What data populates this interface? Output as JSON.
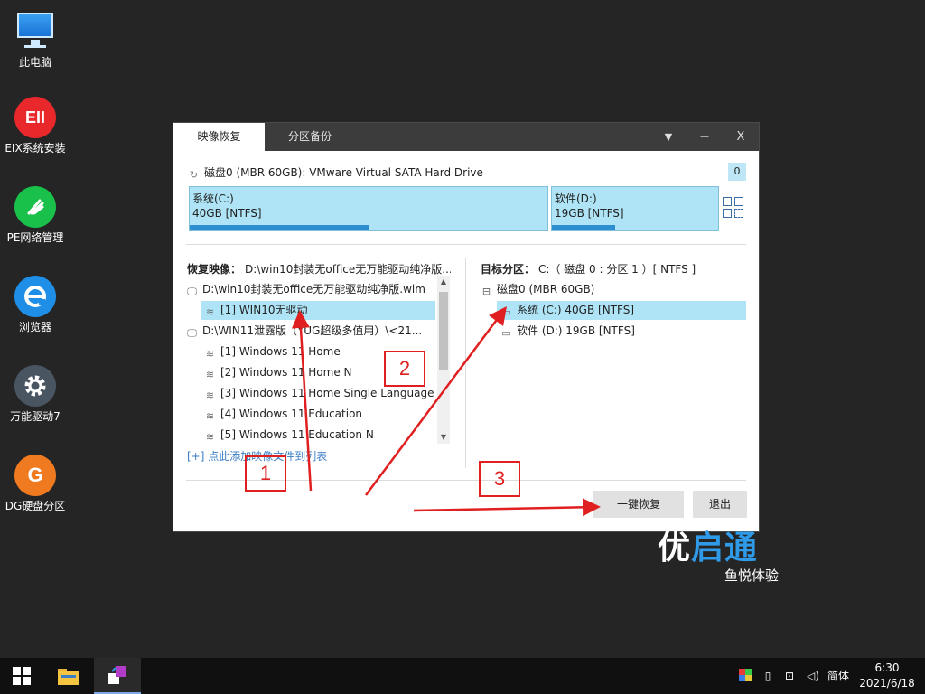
{
  "desktop": {
    "icons": [
      {
        "label": "此电脑"
      },
      {
        "label": "EIX系统安装",
        "text": "EII",
        "color": "#e8282a"
      },
      {
        "label": "PE网络管理",
        "color": "#19c04a"
      },
      {
        "label": "浏览器",
        "color": "#1e8ee6"
      },
      {
        "label": "万能驱动7",
        "color": "#4a5562"
      },
      {
        "label": "DG硬盘分区",
        "text": "G",
        "color": "#f07a20"
      }
    ]
  },
  "window": {
    "tabs": [
      "映像恢复",
      "分区备份"
    ],
    "controls": {
      "dropdown": "▼",
      "minimize": "—",
      "close": "X"
    },
    "disk_label": "磁盘0 (MBR 60GB): VMware Virtual SATA Hard Drive",
    "disk_index": "0",
    "partitions": [
      {
        "name": "系统(C:)",
        "size": "40GB [NTFS]",
        "used_fraction": 0.5
      },
      {
        "name": "软件(D:)",
        "size": "19GB [NTFS]",
        "used_fraction": 0.38
      }
    ],
    "restore_image": {
      "label": "恢复映像：",
      "value": "D:\\win10封装无office无万能驱动纯净版...",
      "tree": [
        {
          "text": "D:\\win10封装无office无万能驱动纯净版.wim",
          "level": 0,
          "icon": "monitor"
        },
        {
          "text": "[1] WIN10无驱动",
          "level": 1,
          "icon": "layers",
          "selected": true
        },
        {
          "text": "D:\\WIN11泄露版（YUG超级多值用）\\<21...",
          "level": 0,
          "icon": "monitor"
        },
        {
          "text": "[1] Windows 11 Home",
          "level": 1,
          "icon": "layers"
        },
        {
          "text": "[2] Windows 11 Home N",
          "level": 1,
          "icon": "layers"
        },
        {
          "text": "[3] Windows 11 Home Single Language",
          "level": 1,
          "icon": "layers"
        },
        {
          "text": "[4] Windows 11 Education",
          "level": 1,
          "icon": "layers"
        },
        {
          "text": "[5] Windows 11 Education N",
          "level": 1,
          "icon": "layers"
        }
      ],
      "add_link": "[+] 点此添加映像文件到列表"
    },
    "target_partition": {
      "label": "目标分区：",
      "value": "C:（ 磁盘 0 : 分区 1 ）[ NTFS ]",
      "tree": [
        {
          "text": "磁盘0 (MBR 60GB)",
          "level": 0,
          "icon": "disk"
        },
        {
          "text": "系统 (C:) 40GB [NTFS]",
          "level": 1,
          "icon": "folder",
          "selected": true
        },
        {
          "text": "软件 (D:) 19GB [NTFS]",
          "level": 1,
          "icon": "folder"
        }
      ]
    },
    "buttons": {
      "restore": "一键恢复",
      "exit": "退出"
    }
  },
  "annotations": [
    "1",
    "2",
    "3"
  ],
  "brand": {
    "part1": "优",
    "part2": "启通",
    "sub": "鱼悦体验"
  },
  "taskbar": {
    "ime": "简体",
    "time": "6:30",
    "date": "2021/6/18"
  },
  "colors": {
    "accent": "#aee4f6",
    "bar": "#2e8fd0",
    "annotation": "#e02020"
  }
}
